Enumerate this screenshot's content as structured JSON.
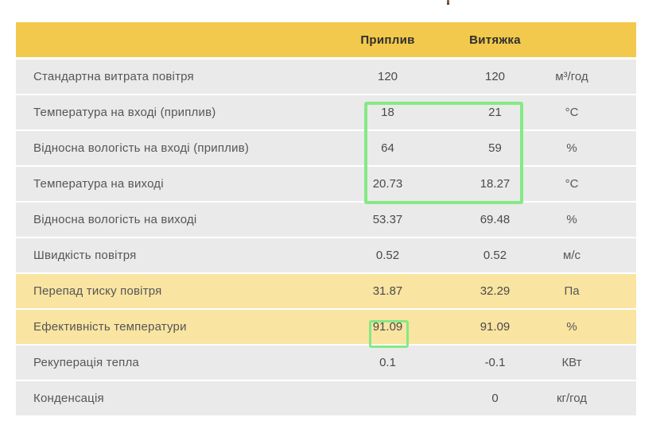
{
  "table": {
    "header": {
      "supply_label": "Приплив",
      "exhaust_label": "Витяжка"
    },
    "rows": [
      {
        "label": "Стандартна витрата повітря",
        "supply": "120",
        "exhaust": "120",
        "unit": "м³/год",
        "tone": "gray"
      },
      {
        "label": "Температура на вході (приплив)",
        "supply": "18",
        "exhaust": "21",
        "unit": "°C",
        "tone": "gray"
      },
      {
        "label": "Відносна вологість на вході (приплив)",
        "supply": "64",
        "exhaust": "59",
        "unit": "%",
        "tone": "gray"
      },
      {
        "label": "Температура на виході",
        "supply": "20.73",
        "exhaust": "18.27",
        "unit": "°C",
        "tone": "gray"
      },
      {
        "label": "Відносна вологість на виході",
        "supply": "53.37",
        "exhaust": "69.48",
        "unit": "%",
        "tone": "gray"
      },
      {
        "label": "Швидкість повітря",
        "supply": "0.52",
        "exhaust": "0.52",
        "unit": "м/с",
        "tone": "gray"
      },
      {
        "label": "Перепад тиску повітря",
        "supply": "31.87",
        "exhaust": "32.29",
        "unit": "Па",
        "tone": "yellow"
      },
      {
        "label": "Ефективність температури",
        "supply": "91.09",
        "exhaust": "91.09",
        "unit": "%",
        "tone": "yellow"
      },
      {
        "label": "Рекуперація тепла",
        "supply": "0.1",
        "exhaust": "-0.1",
        "unit": "КВт",
        "tone": "gray"
      },
      {
        "label": "Конденсація",
        "supply": "",
        "exhaust": "0",
        "unit": "кг/год",
        "tone": "gray"
      }
    ]
  },
  "colors": {
    "header_yellow": "#f2c94c",
    "row_gray": "#eaeaea",
    "row_yellow": "#f9e4a1",
    "highlight_green": "#85e985",
    "header_text": "#2e2e2e",
    "body_text": "#565656"
  },
  "annotations": {
    "big_box_target": "supply and exhaust values of rows: temperature inlet, humidity inlet, temperature outlet",
    "small_box_target": "supply value of temperature efficiency row"
  }
}
